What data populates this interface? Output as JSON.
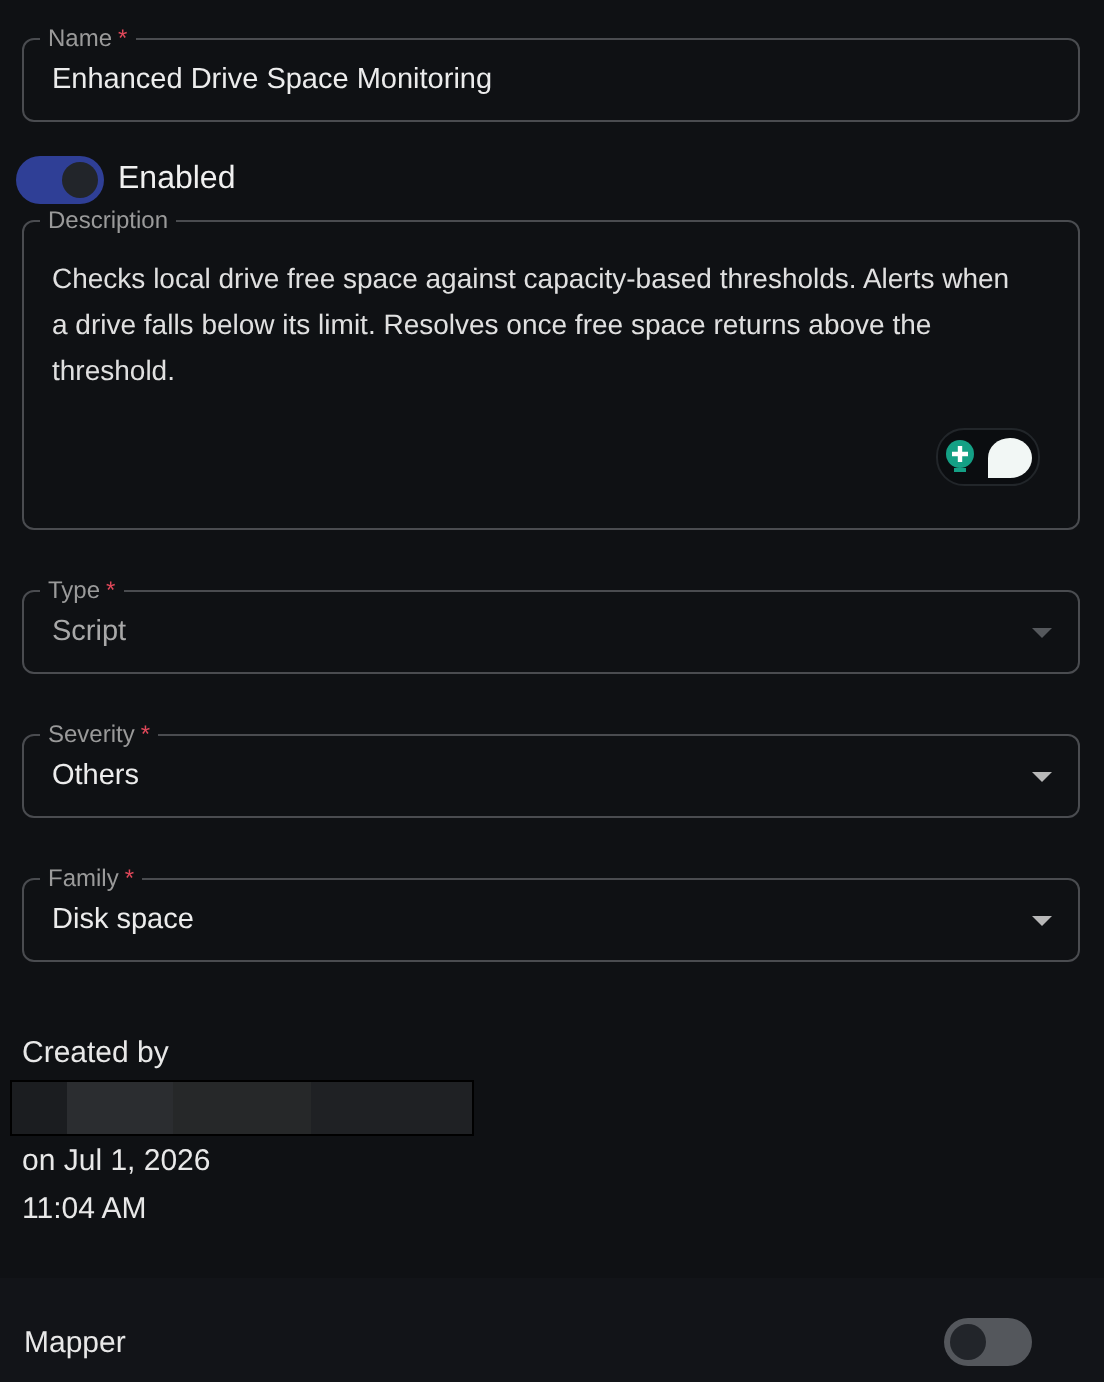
{
  "name_field": {
    "label": "Name",
    "required_mark": "*",
    "value": "Enhanced Drive Space Monitoring"
  },
  "enabled_toggle": {
    "label": "Enabled",
    "on": true
  },
  "description": {
    "label": "Description",
    "value": "Checks local drive free space against capacity-based thresholds. Alerts when a drive falls below its limit. Resolves once free space returns above the threshold."
  },
  "selects": [
    {
      "label": "Type",
      "required_mark": "*",
      "value": "Script",
      "disabled": true
    },
    {
      "label": "Severity",
      "required_mark": "*",
      "value": "Others",
      "disabled": false
    },
    {
      "label": "Family",
      "required_mark": "*",
      "value": "Disk space",
      "disabled": false
    }
  ],
  "created": {
    "label": "Created by",
    "author_redacted": true,
    "date": "on Jul 1, 2026",
    "time": "11:04 AM"
  },
  "mapper": {
    "label": "Mapper",
    "on": false
  }
}
